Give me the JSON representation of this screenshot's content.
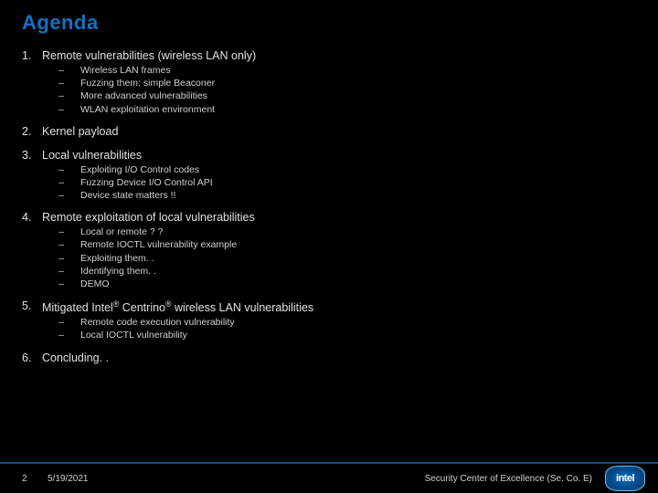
{
  "title": "Agenda",
  "items": [
    {
      "num": "1.",
      "label": "Remote vulnerabilities (wireless LAN only)",
      "subs": [
        "Wireless LAN frames",
        "Fuzzing them: simple Beaconer",
        "More advanced vulnerabilities",
        "WLAN exploitation environment"
      ]
    },
    {
      "num": "2.",
      "label": "Kernel payload",
      "subs": []
    },
    {
      "num": "3.",
      "label": "Local vulnerabilities",
      "subs": [
        "Exploiting I/O Control codes",
        "Fuzzing Device I/O Control API",
        "Device state matters !!"
      ]
    },
    {
      "num": "4.",
      "label": "Remote exploitation of local vulnerabilities",
      "subs": [
        "Local or remote ? ?",
        "Remote IOCTL vulnerability example",
        "Exploiting them. .",
        "Identifying them. .",
        "DEMO"
      ]
    },
    {
      "num": "5.",
      "label_html": "Mitigated Intel<sup>®</sup> Centrino<sup>®</sup> wireless LAN vulnerabilities",
      "label": "Mitigated Intel® Centrino® wireless LAN vulnerabilities",
      "subs": [
        "Remote code execution vulnerability",
        "Local IOCTL vulnerability"
      ]
    },
    {
      "num": "6.",
      "label": "Concluding. .",
      "subs": []
    }
  ],
  "footer": {
    "page": "2",
    "date": "5/19/2021",
    "org": "Security Center of Excellence (Se. Co. E)",
    "logo": "intel"
  }
}
